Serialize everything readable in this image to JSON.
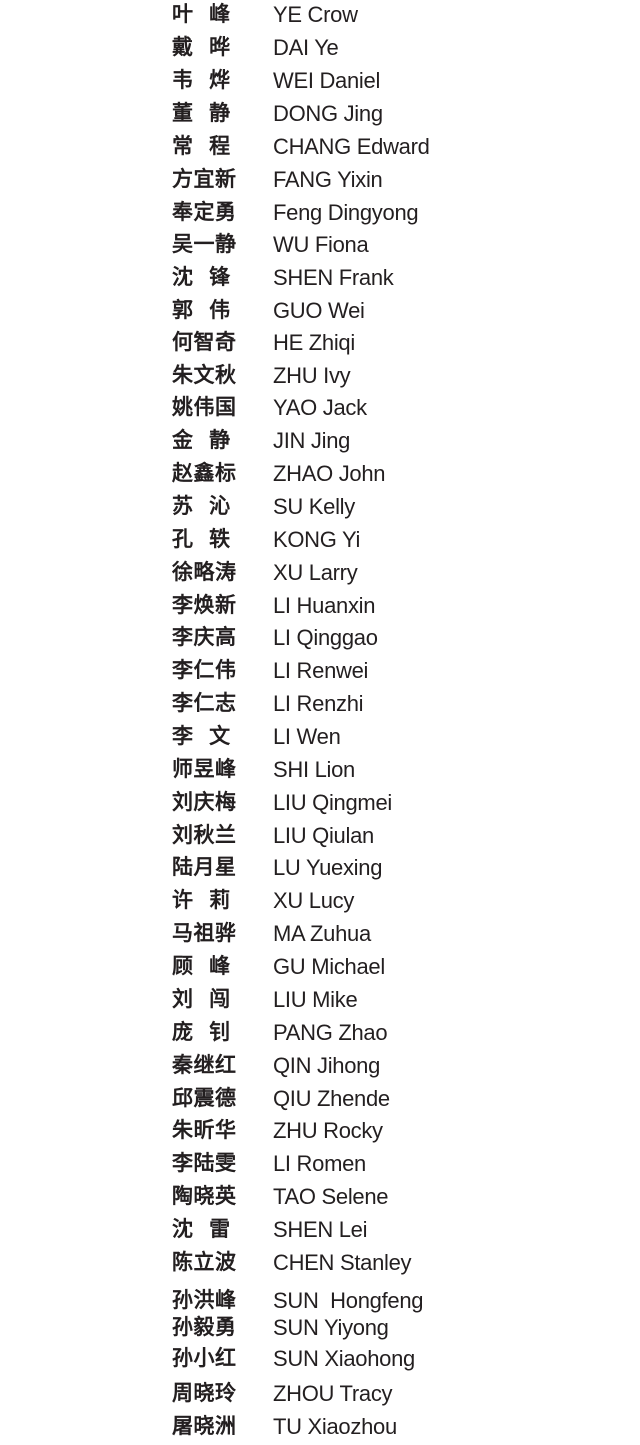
{
  "entries": [
    {
      "zh": "叶  峰",
      "en": "YE Crow"
    },
    {
      "zh": "戴  晔",
      "en": "DAI Ye"
    },
    {
      "zh": "韦  烨",
      "en": "WEI Daniel"
    },
    {
      "zh": "董  静",
      "en": "DONG Jing"
    },
    {
      "zh": "常  程",
      "en": "CHANG Edward"
    },
    {
      "zh": "方宜新",
      "en": "FANG Yixin"
    },
    {
      "zh": "奉定勇",
      "en": "Feng Dingyong"
    },
    {
      "zh": "吴一静",
      "en": "WU Fiona"
    },
    {
      "zh": "沈  锋",
      "en": "SHEN Frank"
    },
    {
      "zh": "郭  伟",
      "en": "GUO Wei"
    },
    {
      "zh": "何智奇",
      "en": "HE Zhiqi"
    },
    {
      "zh": "朱文秋",
      "en": "ZHU Ivy"
    },
    {
      "zh": "姚伟国",
      "en": "YAO Jack"
    },
    {
      "zh": "金  静",
      "en": "JIN Jing"
    },
    {
      "zh": "赵鑫标",
      "en": "ZHAO John"
    },
    {
      "zh": "苏  沁",
      "en": "SU Kelly"
    },
    {
      "zh": "孔  轶",
      "en": "KONG Yi"
    },
    {
      "zh": "徐略涛",
      "en": "XU Larry"
    },
    {
      "zh": "李焕新",
      "en": "LI Huanxin"
    },
    {
      "zh": "李庆高",
      "en": "LI Qinggao"
    },
    {
      "zh": "李仁伟",
      "en": "LI Renwei"
    },
    {
      "zh": "李仁志",
      "en": "LI Renzhi"
    },
    {
      "zh": "李  文",
      "en": "LI Wen"
    },
    {
      "zh": "师昱峰",
      "en": "SHI Lion"
    },
    {
      "zh": "刘庆梅",
      "en": "LIU Qingmei"
    },
    {
      "zh": "刘秋兰",
      "en": "LIU Qiulan"
    },
    {
      "zh": "陆月星",
      "en": "LU Yuexing"
    },
    {
      "zh": "许  莉",
      "en": "XU Lucy"
    },
    {
      "zh": "马祖骅",
      "en": "MA Zuhua"
    },
    {
      "zh": "顾  峰",
      "en": "GU Michael"
    },
    {
      "zh": "刘  闯",
      "en": "LIU Mike"
    },
    {
      "zh": "庞  钊",
      "en": "PANG Zhao"
    },
    {
      "zh": "秦继红",
      "en": "QIN Jihong"
    },
    {
      "zh": "邱震德",
      "en": "QIU Zhende"
    },
    {
      "zh": "朱昕华",
      "en": "ZHU Rocky"
    },
    {
      "zh": "李陆雯",
      "en": "LI Romen"
    },
    {
      "zh": "陶晓英",
      "en": "TAO Selene"
    },
    {
      "zh": "沈  雷",
      "en": "SHEN Lei"
    },
    {
      "zh": "陈立波",
      "en": "CHEN Stanley"
    },
    {
      "zh": "孙洪峰",
      "en": "SUN  Hongfeng"
    },
    {
      "zh": "孙毅勇",
      "en": "SUN Yiyong"
    },
    {
      "zh": "孙小红",
      "en": "SUN Xiaohong"
    },
    {
      "zh": "周晓玲",
      "en": "ZHOU Tracy"
    },
    {
      "zh": "屠晓洲",
      "en": "TU Xiaozhou"
    }
  ]
}
